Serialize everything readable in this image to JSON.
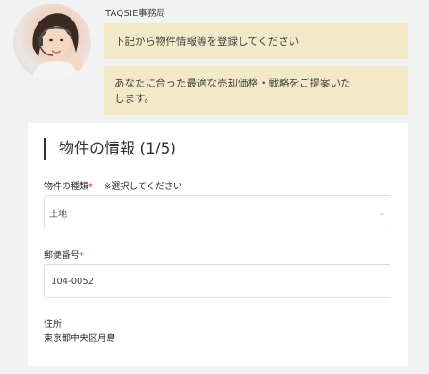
{
  "chat": {
    "sender": "TAQSIE事務局",
    "messages": [
      "下記から物件情報等を登録してください",
      "あなたに合った最適な売却価格・戦略をご提案いたします。"
    ]
  },
  "form": {
    "section_title": "物件の情報 (1/5)",
    "property_type": {
      "label": "物件の種類",
      "required_mark": "*",
      "note": "※選択してください",
      "selected": "土地"
    },
    "postal_code": {
      "label": "郵便番号",
      "required_mark": "*",
      "value": "104-0052"
    },
    "address": {
      "label": "住所",
      "value": "東京都中央区月島"
    }
  },
  "colors": {
    "bubble_bg": "#f1e9c8",
    "required": "#c0392b",
    "page_bg": "#f2f2f2"
  }
}
